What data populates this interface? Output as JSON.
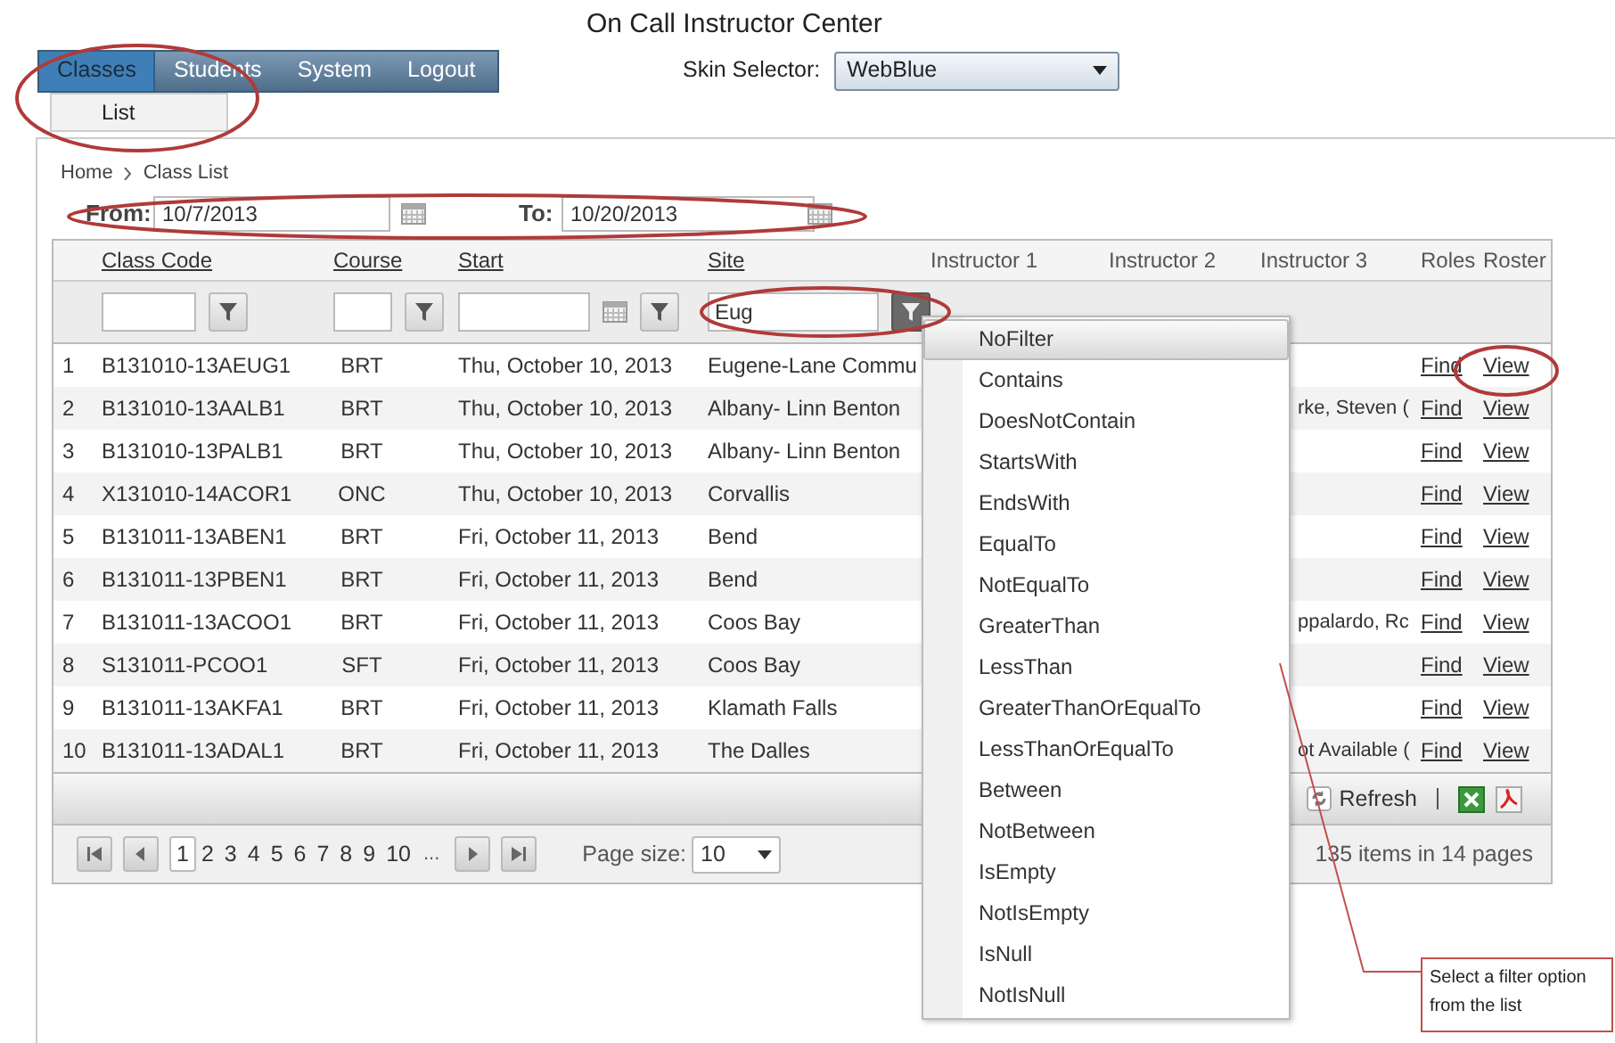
{
  "title": "On Call Instructor Center",
  "menu": [
    {
      "label": "Classes",
      "selected": true
    },
    {
      "label": "Students",
      "selected": false
    },
    {
      "label": "System",
      "selected": false
    },
    {
      "label": "Logout",
      "selected": false
    }
  ],
  "submenu": [
    {
      "label": "List"
    }
  ],
  "skin_selector": {
    "label": "Skin Selector:",
    "value": "WebBlue"
  },
  "breadcrumb": [
    "Home",
    "Class List"
  ],
  "date_range": {
    "from_label": "From:",
    "from": "10/7/2013",
    "to_label": "To:",
    "to": "10/20/2013"
  },
  "grid": {
    "columns": [
      {
        "label": "Class Code",
        "sortable": true,
        "filter": {
          "kind": "text",
          "active": false
        }
      },
      {
        "label": "Course",
        "sortable": true,
        "filter": {
          "kind": "text",
          "active": false
        }
      },
      {
        "label": "Start",
        "sortable": true,
        "filter": {
          "kind": "date",
          "active": false
        }
      },
      {
        "label": "Site",
        "sortable": true,
        "filter": {
          "kind": "text",
          "value": "Eug",
          "active": true
        }
      },
      {
        "label": "Instructor 1",
        "sortable": false
      },
      {
        "label": "Instructor 2",
        "sortable": false
      },
      {
        "label": "Instructor 3",
        "sortable": false
      },
      {
        "label": "Roles",
        "sortable": false
      },
      {
        "label": "Roster",
        "sortable": false
      }
    ],
    "rows": [
      {
        "number": "1",
        "class_code": "B131010-13AEUG1",
        "course": "BRT",
        "start": "Thu, October 10, 2013",
        "site": "Eugene-Lane Commu",
        "roles": "Find",
        "roster": "View"
      },
      {
        "number": "2",
        "class_code": "B131010-13AALB1",
        "course": "BRT",
        "start": "Thu, October 10, 2013",
        "site": "Albany- Linn Benton",
        "instructor_3": "rke, Steven (",
        "roles": "Find",
        "roster": "View"
      },
      {
        "number": "3",
        "class_code": "B131010-13PALB1",
        "course": "BRT",
        "start": "Thu, October 10, 2013",
        "site": "Albany- Linn Benton",
        "roles": "Find",
        "roster": "View"
      },
      {
        "number": "4",
        "class_code": "X131010-14ACOR1",
        "course": "ONC",
        "start": "Thu, October 10, 2013",
        "site": "Corvallis",
        "roles": "Find",
        "roster": "View"
      },
      {
        "number": "5",
        "class_code": "B131011-13ABEN1",
        "course": "BRT",
        "start": "Fri, October 11, 2013",
        "site": "Bend",
        "roles": "Find",
        "roster": "View"
      },
      {
        "number": "6",
        "class_code": "B131011-13PBEN1",
        "course": "BRT",
        "start": "Fri, October 11, 2013",
        "site": "Bend",
        "roles": "Find",
        "roster": "View"
      },
      {
        "number": "7",
        "class_code": "B131011-13ACOO1",
        "course": "BRT",
        "start": "Fri, October 11, 2013",
        "site": "Coos Bay",
        "instructor_3": "ppalardo, Rc",
        "roles": "Find",
        "roster": "View"
      },
      {
        "number": "8",
        "class_code": "S131011-PCOO1",
        "course": "SFT",
        "start": "Fri, October 11, 2013",
        "site": "Coos Bay",
        "roles": "Find",
        "roster": "View"
      },
      {
        "number": "9",
        "class_code": "B131011-13AKFA1",
        "course": "BRT",
        "start": "Fri, October 11, 2013",
        "site": "Klamath Falls",
        "roles": "Find",
        "roster": "View"
      },
      {
        "number": "10",
        "class_code": "B131011-13ADAL1",
        "course": "BRT",
        "start": "Fri, October 11, 2013",
        "site": "The Dalles",
        "instructor_3": "ot Available (",
        "roles": "Find",
        "roster": "View"
      }
    ],
    "toolbar": {
      "refresh": "Refresh"
    },
    "pager": {
      "pages": [
        {
          "label": "1",
          "selected": true
        },
        {
          "label": "2",
          "selected": false
        },
        {
          "label": "3",
          "selected": false
        },
        {
          "label": "4",
          "selected": false
        },
        {
          "label": "5",
          "selected": false
        },
        {
          "label": "6",
          "selected": false
        },
        {
          "label": "7",
          "selected": false
        },
        {
          "label": "8",
          "selected": false
        },
        {
          "label": "9",
          "selected": false
        },
        {
          "label": "10",
          "selected": false
        }
      ],
      "more": "...",
      "page_size_label": "Page size:",
      "page_size": "10",
      "summary": "135 items in 14 pages"
    }
  },
  "filter_menu": {
    "items": [
      {
        "label": "NoFilter",
        "selected": true
      },
      {
        "label": "Contains",
        "selected": false
      },
      {
        "label": "DoesNotContain",
        "selected": false
      },
      {
        "label": "StartsWith",
        "selected": false
      },
      {
        "label": "EndsWith",
        "selected": false
      },
      {
        "label": "EqualTo",
        "selected": false
      },
      {
        "label": "NotEqualTo",
        "selected": false
      },
      {
        "label": "GreaterThan",
        "selected": false
      },
      {
        "label": "LessThan",
        "selected": false
      },
      {
        "label": "GreaterThanOrEqualTo",
        "selected": false
      },
      {
        "label": "LessThanOrEqualTo",
        "selected": false
      },
      {
        "label": "Between",
        "selected": false
      },
      {
        "label": "NotBetween",
        "selected": false
      },
      {
        "label": "IsEmpty",
        "selected": false
      },
      {
        "label": "NotIsEmpty",
        "selected": false
      },
      {
        "label": "IsNull",
        "selected": false
      },
      {
        "label": "NotIsNull",
        "selected": false
      }
    ]
  },
  "annotation": {
    "text": "Select a filter option from the list"
  }
}
